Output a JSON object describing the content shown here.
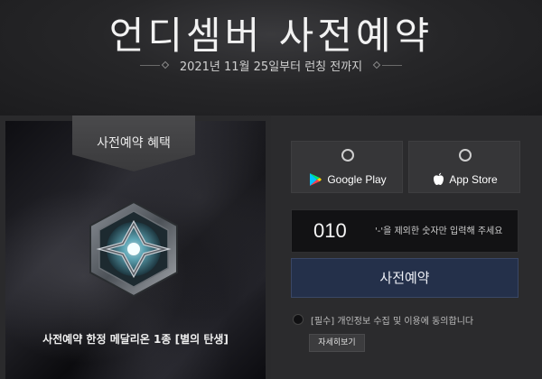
{
  "header": {
    "title": "언디셈버 사전예약",
    "subtitle": "2021년 11월 25일부터 런칭 전까지"
  },
  "reward": {
    "badge_label": "사전예약 혜택",
    "description": "사전예약 한정 메달리온 1종 [별의 탄생]",
    "medal_icon": "hexagon-star-medallion-icon"
  },
  "stores": {
    "google": {
      "label": "Google Play",
      "icon": "google-play-icon"
    },
    "apple": {
      "label": "App Store",
      "icon": "apple-icon"
    }
  },
  "phone": {
    "prefix": "010",
    "placeholder": "'-'을 제외한 숫자만 입력해 주세요"
  },
  "submit": {
    "label": "사전예약"
  },
  "agreement": {
    "text": "[필수] 개인정보 수집 및 이용에 동의합니다",
    "detail_label": "자세히보기"
  },
  "colors": {
    "background": "#1a1a1c",
    "submit_button": "#24304a",
    "panel": "#2b2b2d"
  }
}
